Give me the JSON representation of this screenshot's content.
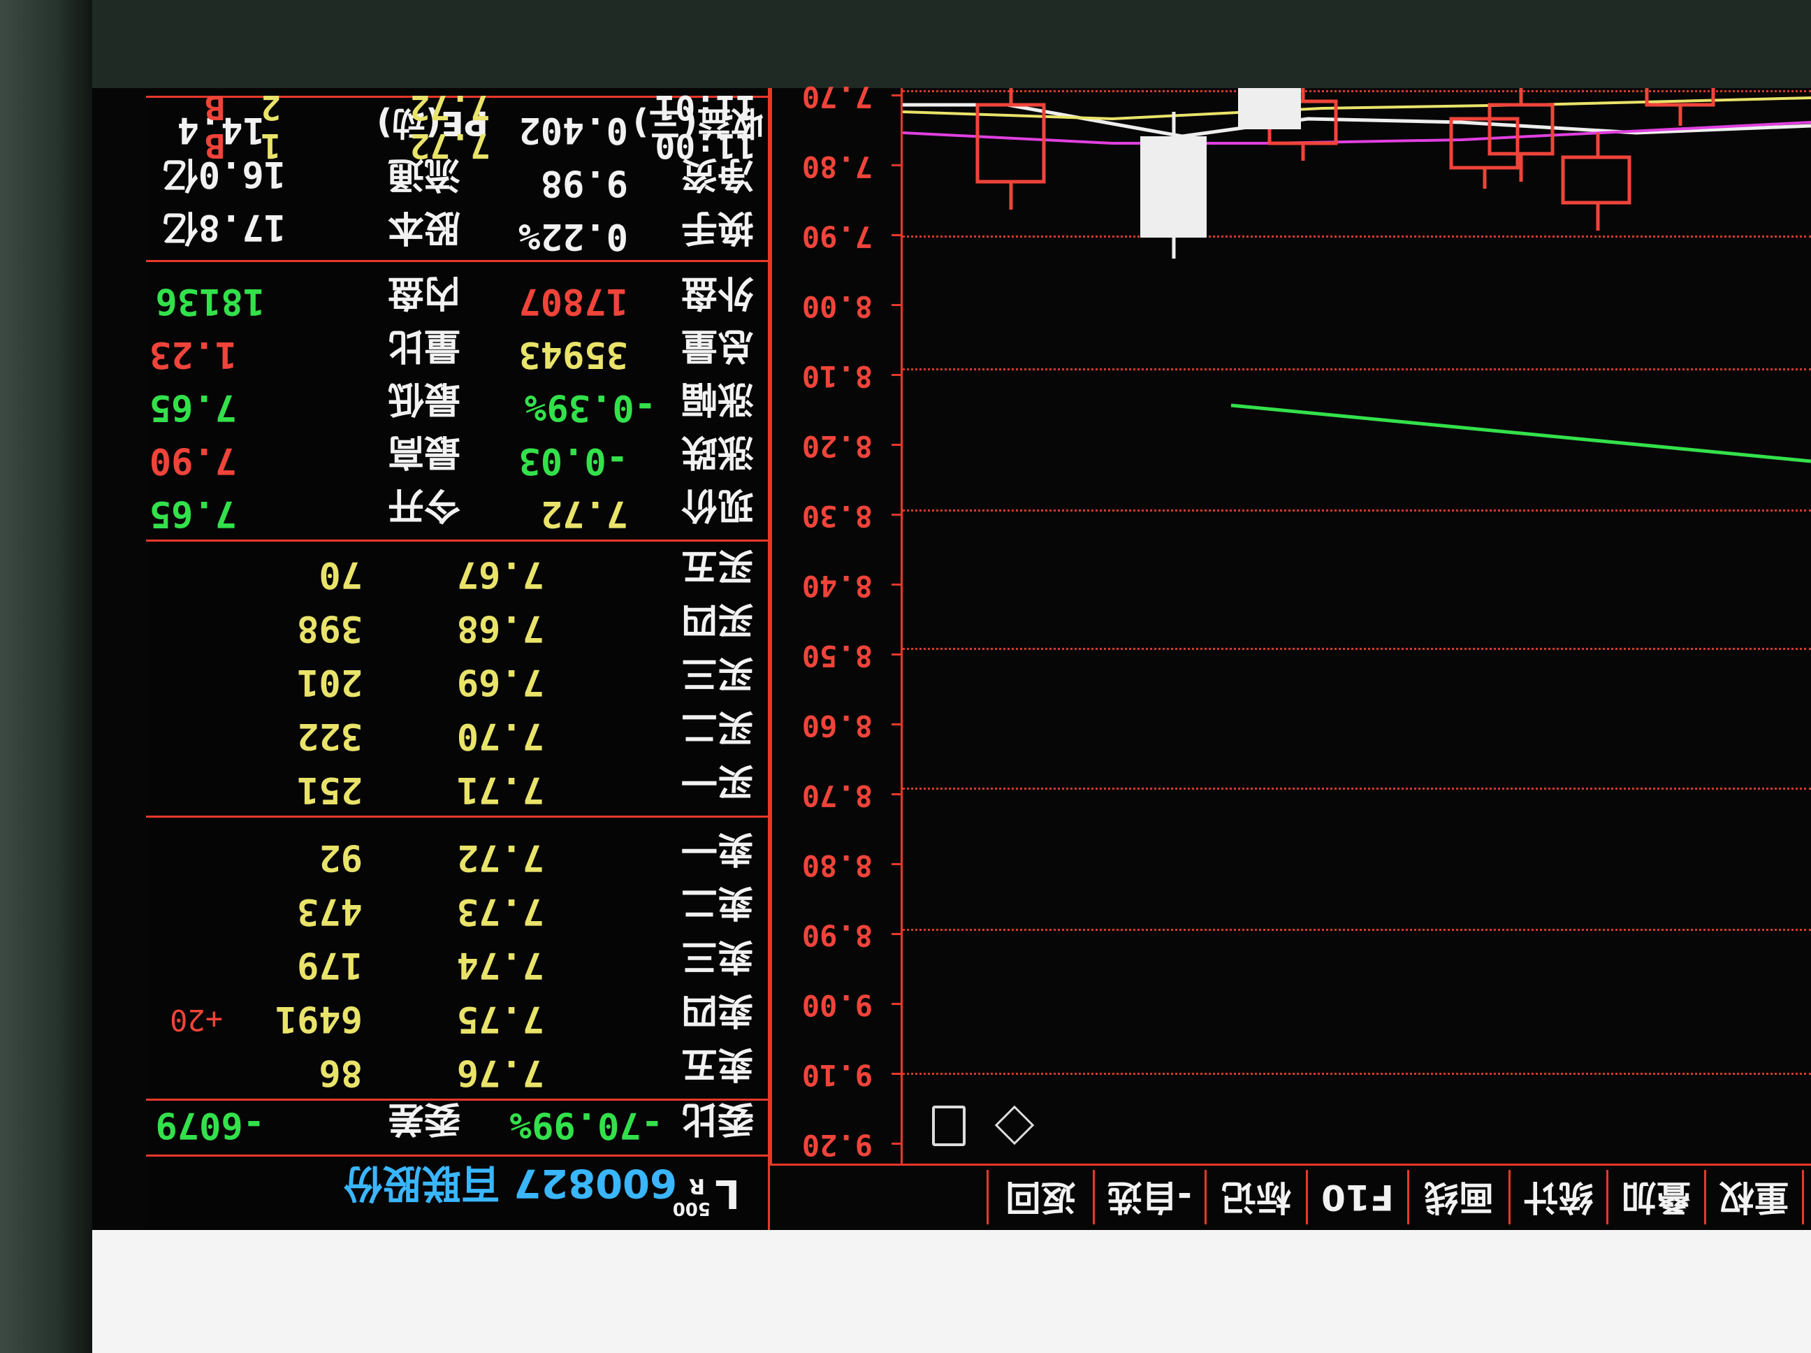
{
  "stock": {
    "code_name": "600827 百联股份",
    "prefix": "L",
    "tag": "R",
    "sup": "500"
  },
  "toolbar": [
    "重权",
    "叠加",
    "统计",
    "画线",
    "F10",
    "标记",
    "-自选",
    "返回"
  ],
  "committee": {
    "label": "委比",
    "ratio": "-70.99%",
    "diff_label": "委差",
    "diff": "-6079"
  },
  "sell": [
    {
      "label": "卖五",
      "price": "7.76",
      "vol": "86",
      "chg": ""
    },
    {
      "label": "卖四",
      "price": "7.75",
      "vol": "6491",
      "chg": "+20"
    },
    {
      "label": "卖三",
      "price": "7.74",
      "vol": "179",
      "chg": ""
    },
    {
      "label": "卖二",
      "price": "7.73",
      "vol": "473",
      "chg": ""
    },
    {
      "label": "卖一",
      "price": "7.72",
      "vol": "92",
      "chg": ""
    }
  ],
  "buy": [
    {
      "label": "买一",
      "price": "7.71",
      "vol": "251"
    },
    {
      "label": "买二",
      "price": "7.70",
      "vol": "322"
    },
    {
      "label": "买三",
      "price": "7.69",
      "vol": "201"
    },
    {
      "label": "买四",
      "price": "7.68",
      "vol": "398"
    },
    {
      "label": "买五",
      "price": "7.67",
      "vol": "70"
    }
  ],
  "stats": [
    {
      "l1": "现价",
      "v1": "7.72",
      "l2": "今开",
      "v2": "7.65"
    },
    {
      "l1": "涨跌",
      "v1": "-0.03",
      "l2": "最高",
      "v2": "7.90"
    },
    {
      "l1": "涨幅",
      "v1": "-0.39%",
      "l2": "最低",
      "v2": "7.65"
    },
    {
      "l1": "总量",
      "v1": "35943",
      "l2": "量比",
      "v2": "1.23"
    },
    {
      "l1": "外盘",
      "v1": "17807",
      "l2": "内盘",
      "v2": "18136"
    }
  ],
  "stats2": [
    {
      "l1": "换手",
      "v1": "0.22%",
      "l2": "股本",
      "v2": "17.8亿"
    },
    {
      "l1": "净资",
      "v1": "9.98",
      "l2": "流通",
      "v2": "16.0亿"
    },
    {
      "l1": "收益(三)",
      "v1": "0.402",
      "l2": "PE(动)",
      "v2": "14.4"
    }
  ],
  "trades": [
    {
      "time": "11:00",
      "price": "7.72",
      "vol": "1",
      "side": "B"
    },
    {
      "time": "11:01",
      "price": "7.72",
      "vol": "2",
      "side": "B"
    }
  ],
  "axis_ticks": [
    "9.20",
    "9.10",
    "9.00",
    "8.90",
    "8.80",
    "8.70",
    "8.60",
    "8.50",
    "8.40",
    "8.30",
    "8.20",
    "8.10",
    "8.00",
    "7.90",
    "7.80",
    "7.70"
  ],
  "colors": {
    "up": "#f0443a",
    "down": "#33e14b",
    "grid": "#e8382a",
    "level": "#e9e36a",
    "info": "#3ab6ff"
  }
}
